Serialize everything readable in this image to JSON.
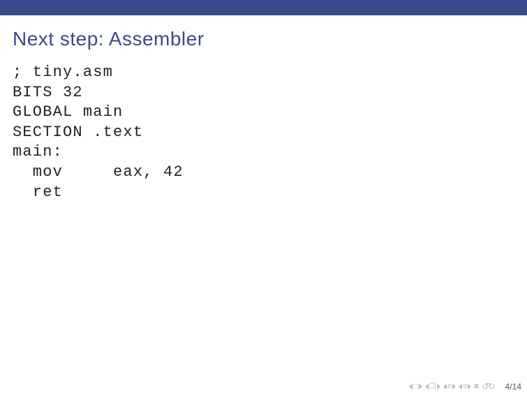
{
  "slide": {
    "title": "Next step: Assembler",
    "code": "; tiny.asm\nBITS 32\nGLOBAL main\nSECTION .text\nmain:\n  mov     eax, 42\n  ret"
  },
  "footer": {
    "page_current": "4",
    "page_sep": "/",
    "page_total": "14"
  }
}
